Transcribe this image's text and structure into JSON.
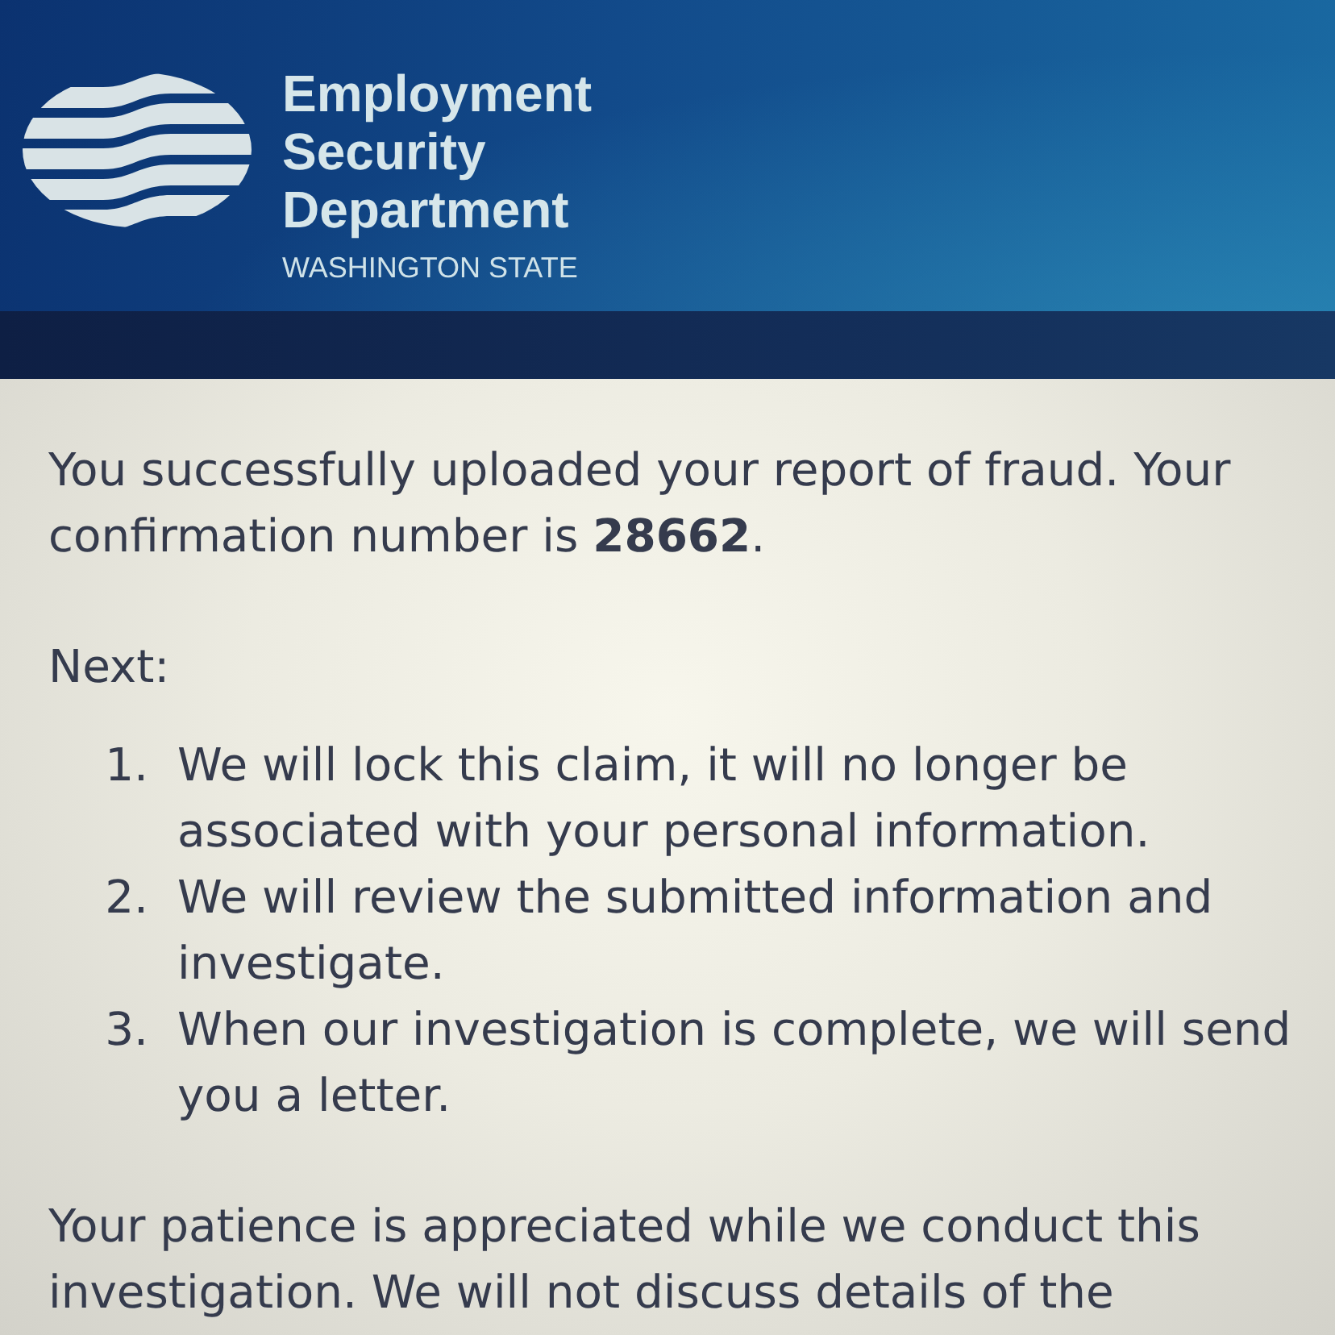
{
  "header": {
    "agency_name": "Employment Security Department",
    "state": "WASHINGTON STATE"
  },
  "message": "You successfully uploaded your report of fraud. Your confirmation number is **28662**.",
  "next_heading": "Next:",
  "steps": [
    {
      "number": "1.",
      "text": "We will lock this claim, it will no longer be associated with your personal information."
    },
    {
      "number": "2.",
      "text": "We will review the submitted information and investigate."
    },
    {
      "number": "3.",
      "text": "When our investigation is complete, we will send you a letter."
    }
  ],
  "closing": "Your patience is appreciated while we conduct this investigation. We will not discuss details of the"
}
